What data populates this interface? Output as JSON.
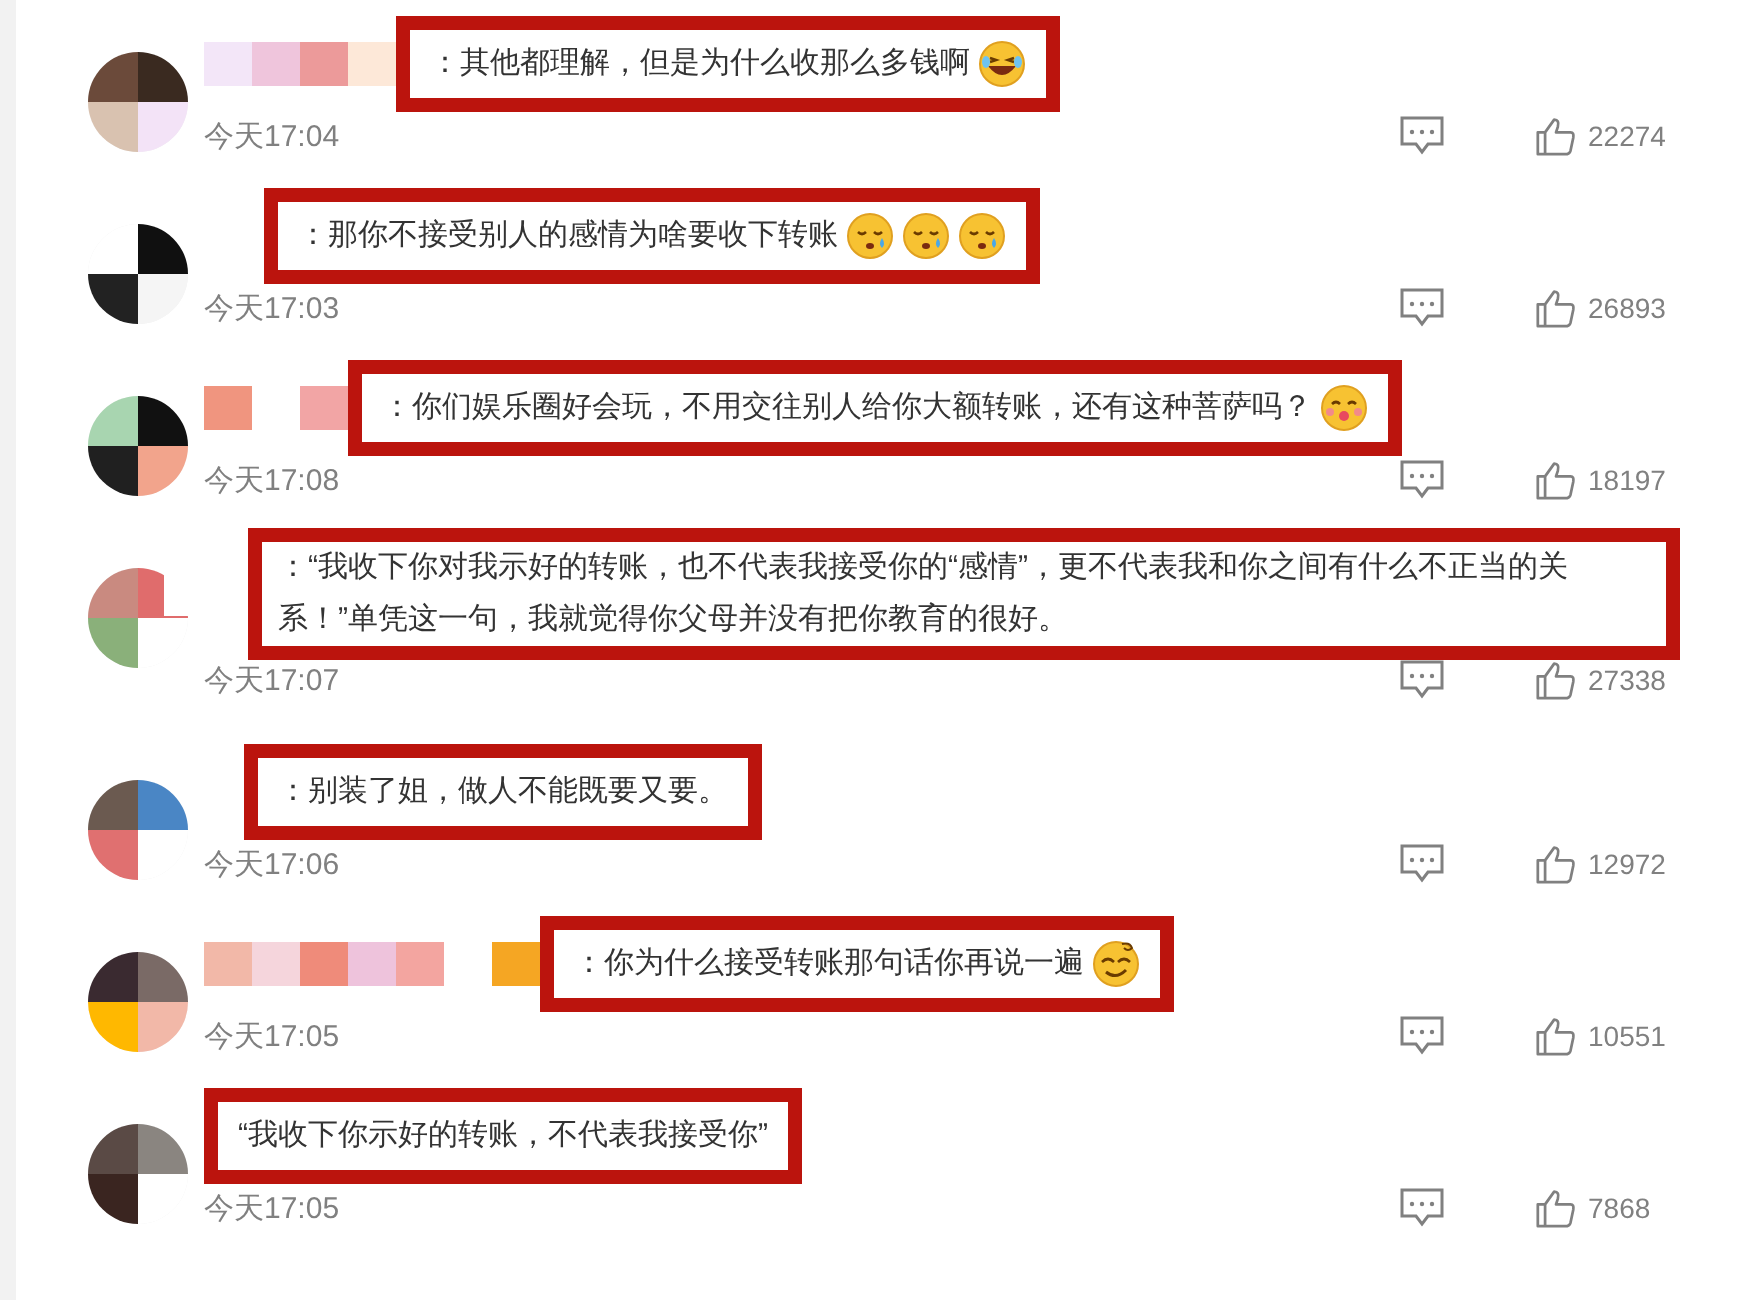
{
  "comments": [
    {
      "separator": "：",
      "text": "其他都理解，但是为什么收那么多钱啊",
      "emojis": [
        {
          "kind": "laughing"
        }
      ],
      "time": "今天17:04",
      "likes": "22274"
    },
    {
      "separator": "：",
      "text": "那你不接受别人的感情为啥要收下转账",
      "emojis": [
        {
          "kind": "sweat"
        },
        {
          "kind": "sweat"
        },
        {
          "kind": "sweat"
        }
      ],
      "time": "今天17:03",
      "likes": "26893"
    },
    {
      "separator": "：",
      "text": "你们娱乐圈好会玩，不用交往别人给你大额转账，还有这种菩萨吗？",
      "emojis": [
        {
          "kind": "kiss"
        }
      ],
      "time": "今天17:08",
      "likes": "18197"
    },
    {
      "separator": "：",
      "text": "“我收下你对我示好的转账，也不代表我接受你的“感情”，更不代表我和你之间有什么不正当的关系！”单凭这一句，我就觉得你父母并没有把你教育的很好。",
      "time": "今天17:07",
      "likes": "27338"
    },
    {
      "separator": "：",
      "text": "别装了姐，做人不能既要又要。",
      "time": "今天17:06",
      "likes": "12972"
    },
    {
      "separator": "：",
      "text": "你为什么接受转账那句话你再说一遍",
      "emojis": [
        {
          "kind": "dizzy"
        }
      ],
      "time": "今天17:05",
      "likes": "10551"
    },
    {
      "text": "“我收下你示好的转账，不代表我接受你”",
      "time": "今天17:05",
      "likes": "7868"
    }
  ]
}
